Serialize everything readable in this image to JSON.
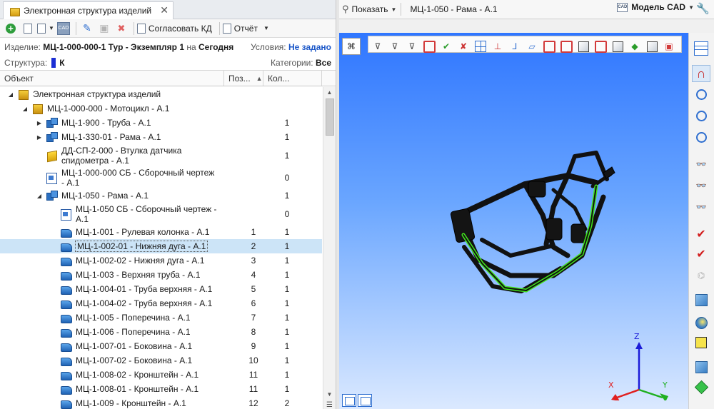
{
  "tab": {
    "title": "Электронная структура изделий",
    "close": "✕"
  },
  "toolbar": {
    "approve_label": "Согласовать КД",
    "report_label": "Отчёт"
  },
  "info": {
    "product_label": "Изделие:",
    "product_value": "МЦ-1-000-000-1 Тур - Экземпляр 1",
    "on_label": "на",
    "date_value": "Сегодня",
    "conditions_label": "Условия:",
    "conditions_value": "Не задано",
    "structure_label": "Структура:",
    "structure_value": "К",
    "categories_label": "Категории:",
    "categories_value": "Все"
  },
  "columns": {
    "object": "Объект",
    "position": "Поз...",
    "quantity": "Кол..."
  },
  "tree": [
    {
      "indent": 0,
      "expander": "◢",
      "icon": "root",
      "name": "Электронная структура изделий",
      "pos": "",
      "qty": ""
    },
    {
      "indent": 1,
      "expander": "◢",
      "icon": "root",
      "name": "МЦ-1-000-000 - Мотоцикл - А.1",
      "pos": "",
      "qty": ""
    },
    {
      "indent": 2,
      "expander": "▶",
      "icon": "asm",
      "name": "МЦ-1-900 - Труба - А.1",
      "pos": "",
      "qty": "1"
    },
    {
      "indent": 2,
      "expander": "▶",
      "icon": "asm",
      "name": "МЦ-1-330-01 - Рама - А.1",
      "pos": "",
      "qty": "1"
    },
    {
      "indent": 2,
      "expander": "",
      "icon": "std",
      "name": "ДД-СП-2-000 - Втулка датчика спидометра - А.1",
      "pos": "",
      "qty": "1",
      "tall": true
    },
    {
      "indent": 2,
      "expander": "",
      "icon": "drw",
      "name": "МЦ-1-000-000 СБ - Сборочный чертеж - А.1",
      "pos": "",
      "qty": "0",
      "tall": true
    },
    {
      "indent": 2,
      "expander": "◢",
      "icon": "asm",
      "name": "МЦ-1-050 - Рама - А.1",
      "pos": "",
      "qty": "1"
    },
    {
      "indent": 3,
      "expander": "",
      "icon": "drw",
      "name": "МЦ-1-050 СБ - Сборочный чертеж - А.1",
      "pos": "",
      "qty": "0",
      "tall": true
    },
    {
      "indent": 3,
      "expander": "",
      "icon": "part",
      "name": "МЦ-1-001 - Рулевая колонка - А.1",
      "pos": "1",
      "qty": "1"
    },
    {
      "indent": 3,
      "expander": "",
      "icon": "part",
      "name": "МЦ-1-002-01 - Нижняя дуга - А.1",
      "pos": "2",
      "qty": "1",
      "selected": true
    },
    {
      "indent": 3,
      "expander": "",
      "icon": "part",
      "name": "МЦ-1-002-02 - Нижняя дуга - А.1",
      "pos": "3",
      "qty": "1"
    },
    {
      "indent": 3,
      "expander": "",
      "icon": "part",
      "name": "МЦ-1-003 - Верхняя труба - А.1",
      "pos": "4",
      "qty": "1"
    },
    {
      "indent": 3,
      "expander": "",
      "icon": "part",
      "name": "МЦ-1-004-01 - Труба верхняя - А.1",
      "pos": "5",
      "qty": "1"
    },
    {
      "indent": 3,
      "expander": "",
      "icon": "part",
      "name": "МЦ-1-004-02 - Труба верхняя - А.1",
      "pos": "6",
      "qty": "1"
    },
    {
      "indent": 3,
      "expander": "",
      "icon": "part",
      "name": "МЦ-1-005 - Поперечина - А.1",
      "pos": "7",
      "qty": "1"
    },
    {
      "indent": 3,
      "expander": "",
      "icon": "part",
      "name": "МЦ-1-006 - Поперечина - А.1",
      "pos": "8",
      "qty": "1"
    },
    {
      "indent": 3,
      "expander": "",
      "icon": "part",
      "name": "МЦ-1-007-01 - Боковина - А.1",
      "pos": "9",
      "qty": "1"
    },
    {
      "indent": 3,
      "expander": "",
      "icon": "part",
      "name": "МЦ-1-007-02 - Боковина - А.1",
      "pos": "10",
      "qty": "1"
    },
    {
      "indent": 3,
      "expander": "",
      "icon": "part",
      "name": "МЦ-1-008-02 - Кронштейн - А.1",
      "pos": "11",
      "qty": "1"
    },
    {
      "indent": 3,
      "expander": "",
      "icon": "part",
      "name": "МЦ-1-008-01 - Кронштейн - А.1",
      "pos": "11",
      "qty": "1"
    },
    {
      "indent": 3,
      "expander": "",
      "icon": "part",
      "name": "МЦ-1-009 - Кронштейн - А.1",
      "pos": "12",
      "qty": "2"
    }
  ],
  "viewer": {
    "show_label": "Показать",
    "model_title": "МЦ-1-050 - Рама - А.1",
    "cad_model_label": "Модель CAD",
    "cad_icon_text": "CAD",
    "axes": {
      "x": "X",
      "y": "Y",
      "z": "Z"
    },
    "colors": {
      "highlight": "#41e61c",
      "frame": "#111111",
      "bg_top": "#2f76ff",
      "bg_bottom": "#dbe9ff"
    }
  }
}
